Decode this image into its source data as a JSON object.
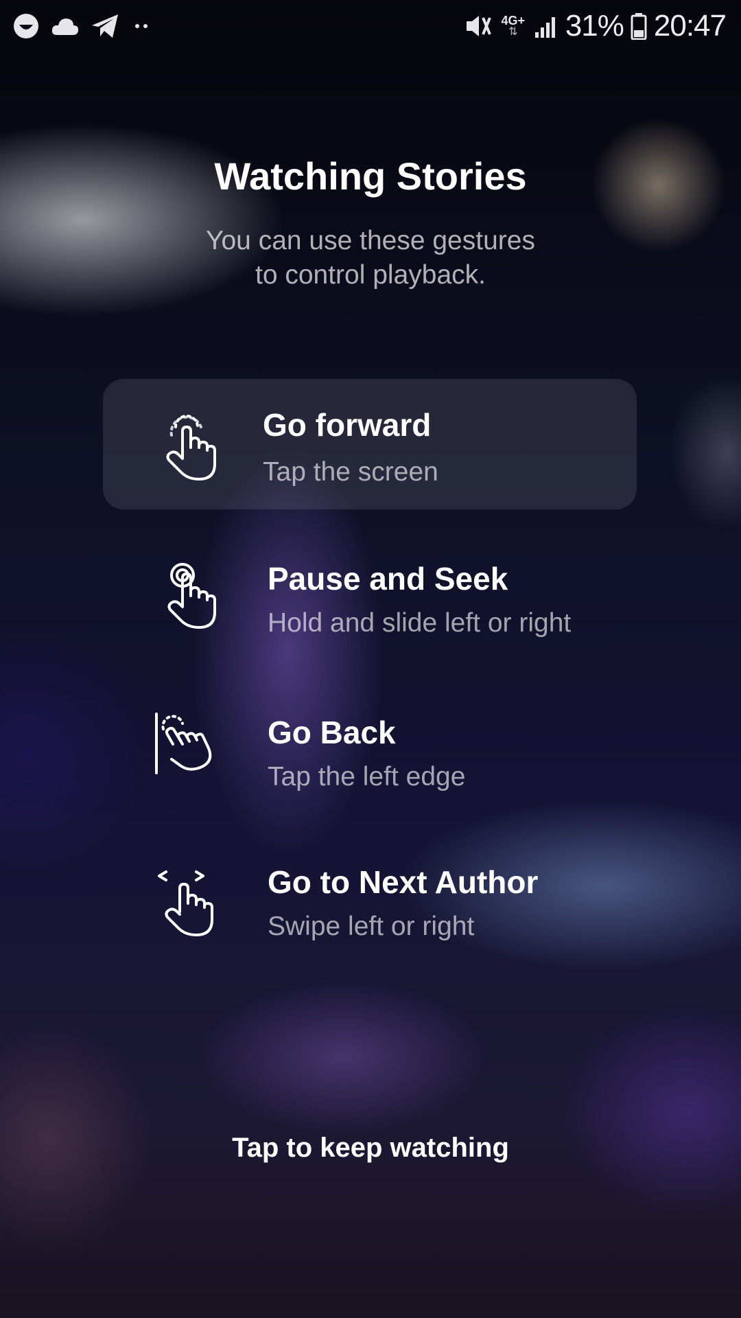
{
  "status_bar": {
    "battery_percent": "31%",
    "time": "20:47",
    "network_type": "4G+",
    "icons_left": [
      "smiley-icon",
      "cloud-icon",
      "telegram-icon",
      "more-dots-icon"
    ],
    "icons_right": [
      "vibrate-mute-icon",
      "network-4g-icon",
      "signal-icon",
      "battery-icon"
    ]
  },
  "header": {
    "title": "Watching Stories",
    "subtitle_line1": "You can use these gestures",
    "subtitle_line2": "to control playback."
  },
  "gestures": [
    {
      "title": "Go forward",
      "subtitle": "Tap the screen",
      "icon": "tap-hand-icon",
      "highlighted": true
    },
    {
      "title": "Pause and Seek",
      "subtitle": "Hold and slide left or right",
      "icon": "hold-hand-icon",
      "highlighted": false
    },
    {
      "title": "Go Back",
      "subtitle": "Tap the left edge",
      "icon": "tap-left-edge-icon",
      "highlighted": false
    },
    {
      "title": "Go to Next Author",
      "subtitle": "Swipe left or right",
      "icon": "swipe-hand-icon",
      "highlighted": false
    }
  ],
  "footer": {
    "label": "Tap to keep watching"
  },
  "colors": {
    "text_primary": "#ffffff",
    "highlight_card": "rgba(255,255,255,0.10)"
  }
}
